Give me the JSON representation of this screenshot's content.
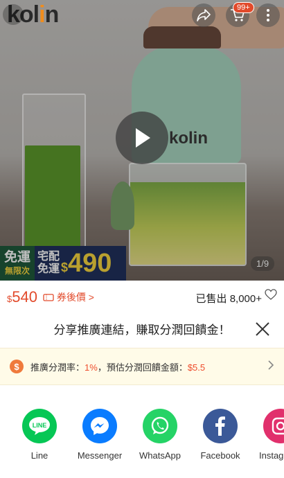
{
  "hero": {
    "brand_logo": "kolin",
    "brand_logo_prefix": "kol",
    "brand_logo_i": "i",
    "brand_logo_suffix": "n",
    "product_logo": "kolin",
    "cart_badge": "99+",
    "image_counter": "1/9",
    "promo": {
      "label_a_line1": "免運",
      "label_a_line2": "無限次",
      "label_b_line1": "宅配",
      "label_b_line2": "免運",
      "currency": "$",
      "amount": "490"
    }
  },
  "price_bar": {
    "currency": "$",
    "price": "540",
    "coupon_label": "券後價 >",
    "sold": "已售出 8,000+"
  },
  "share_sheet": {
    "title": "分享推廣連結，賺取分潤回饋金！",
    "info_prefix": "推廣分潤率：",
    "rate": "1%",
    "info_middle": "，預估分潤回饋金額：",
    "amount": "$5.5",
    "apps": [
      {
        "label": "Line",
        "icon": "line-icon",
        "color": "#06c755"
      },
      {
        "label": "Messenger",
        "icon": "messenger-icon",
        "color": "#0a7cff"
      },
      {
        "label": "WhatsApp",
        "icon": "whatsapp-icon",
        "color": "#25d366"
      },
      {
        "label": "Facebook",
        "icon": "facebook-icon",
        "color": "#3b5998"
      },
      {
        "label": "Instag",
        "icon": "instagram-icon",
        "color": "#e1306c"
      }
    ]
  }
}
